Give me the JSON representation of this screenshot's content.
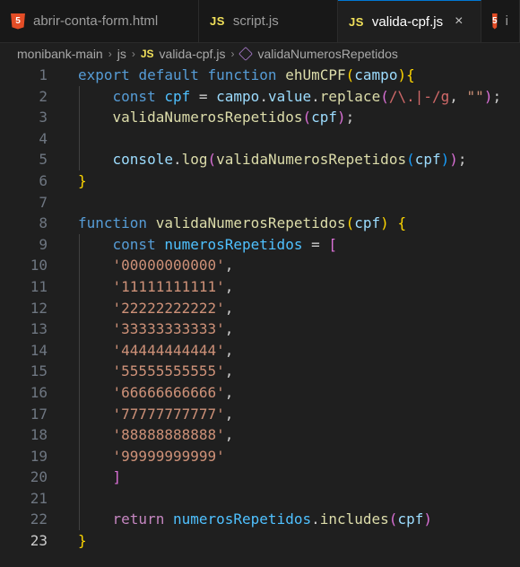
{
  "tabs": [
    {
      "label": "abrir-conta-form.html",
      "icon": "html5-icon",
      "active": false
    },
    {
      "label": "script.js",
      "icon": "js-icon",
      "active": false
    },
    {
      "label": "valida-cpf.js",
      "icon": "js-icon",
      "active": true
    },
    {
      "label": "i",
      "icon": "html5-icon",
      "active": false
    }
  ],
  "icons": {
    "html5": "5",
    "js": "JS",
    "close": "×",
    "chevron": "›"
  },
  "breadcrumb": [
    "monibank-main",
    "js",
    "valida-cpf.js",
    "validaNumerosRepetidos"
  ],
  "current_line": 23,
  "lines": [
    [
      [
        "kw",
        "export "
      ],
      [
        "kw",
        "default "
      ],
      [
        "kw",
        "function "
      ],
      [
        "fn",
        "ehUmCPF"
      ],
      [
        "b1",
        "("
      ],
      [
        "var",
        "campo"
      ],
      [
        "b1",
        ")"
      ],
      [
        "b1",
        "{"
      ]
    ],
    [
      [
        "pl",
        "    "
      ],
      [
        "kw",
        "const "
      ],
      [
        "cst",
        "cpf"
      ],
      [
        "pl",
        " = "
      ],
      [
        "var",
        "campo"
      ],
      [
        "pl",
        "."
      ],
      [
        "var",
        "value"
      ],
      [
        "pl",
        "."
      ],
      [
        "fn",
        "replace"
      ],
      [
        "b2",
        "("
      ],
      [
        "rx",
        "/\\.|-/g"
      ],
      [
        "pl",
        ", "
      ],
      [
        "str",
        "\"\""
      ],
      [
        "b2",
        ")"
      ],
      [
        "pl",
        ";"
      ]
    ],
    [
      [
        "pl",
        "    "
      ],
      [
        "fn",
        "validaNumerosRepetidos"
      ],
      [
        "b2",
        "("
      ],
      [
        "var",
        "cpf"
      ],
      [
        "b2",
        ")"
      ],
      [
        "pl",
        ";"
      ]
    ],
    [],
    [
      [
        "pl",
        "    "
      ],
      [
        "var",
        "console"
      ],
      [
        "pl",
        "."
      ],
      [
        "fn",
        "log"
      ],
      [
        "b2",
        "("
      ],
      [
        "fn",
        "validaNumerosRepetidos"
      ],
      [
        "b3",
        "("
      ],
      [
        "var",
        "cpf"
      ],
      [
        "b3",
        ")"
      ],
      [
        "b2",
        ")"
      ],
      [
        "pl",
        ";"
      ]
    ],
    [
      [
        "b1",
        "}"
      ]
    ],
    [],
    [
      [
        "kw",
        "function "
      ],
      [
        "fn",
        "validaNumerosRepetidos"
      ],
      [
        "b1",
        "("
      ],
      [
        "var",
        "cpf"
      ],
      [
        "b1",
        ")"
      ],
      [
        "pl",
        " "
      ],
      [
        "b1",
        "{"
      ]
    ],
    [
      [
        "pl",
        "    "
      ],
      [
        "kw",
        "const "
      ],
      [
        "cst",
        "numerosRepetidos"
      ],
      [
        "pl",
        " = "
      ],
      [
        "b2",
        "["
      ]
    ],
    [
      [
        "pl",
        "    "
      ],
      [
        "str",
        "'00000000000'"
      ],
      [
        "pl",
        ","
      ]
    ],
    [
      [
        "pl",
        "    "
      ],
      [
        "str",
        "'11111111111'"
      ],
      [
        "pl",
        ","
      ]
    ],
    [
      [
        "pl",
        "    "
      ],
      [
        "str",
        "'22222222222'"
      ],
      [
        "pl",
        ","
      ]
    ],
    [
      [
        "pl",
        "    "
      ],
      [
        "str",
        "'33333333333'"
      ],
      [
        "pl",
        ","
      ]
    ],
    [
      [
        "pl",
        "    "
      ],
      [
        "str",
        "'44444444444'"
      ],
      [
        "pl",
        ","
      ]
    ],
    [
      [
        "pl",
        "    "
      ],
      [
        "str",
        "'55555555555'"
      ],
      [
        "pl",
        ","
      ]
    ],
    [
      [
        "pl",
        "    "
      ],
      [
        "str",
        "'66666666666'"
      ],
      [
        "pl",
        ","
      ]
    ],
    [
      [
        "pl",
        "    "
      ],
      [
        "str",
        "'77777777777'"
      ],
      [
        "pl",
        ","
      ]
    ],
    [
      [
        "pl",
        "    "
      ],
      [
        "str",
        "'88888888888'"
      ],
      [
        "pl",
        ","
      ]
    ],
    [
      [
        "pl",
        "    "
      ],
      [
        "str",
        "'99999999999'"
      ]
    ],
    [
      [
        "pl",
        "    "
      ],
      [
        "b2",
        "]"
      ]
    ],
    [],
    [
      [
        "pl",
        "    "
      ],
      [
        "ctl",
        "return "
      ],
      [
        "cst",
        "numerosRepetidos"
      ],
      [
        "pl",
        "."
      ],
      [
        "fn",
        "includes"
      ],
      [
        "b2",
        "("
      ],
      [
        "var",
        "cpf"
      ],
      [
        "b2",
        ")"
      ]
    ],
    [
      [
        "b1",
        "}"
      ]
    ]
  ]
}
